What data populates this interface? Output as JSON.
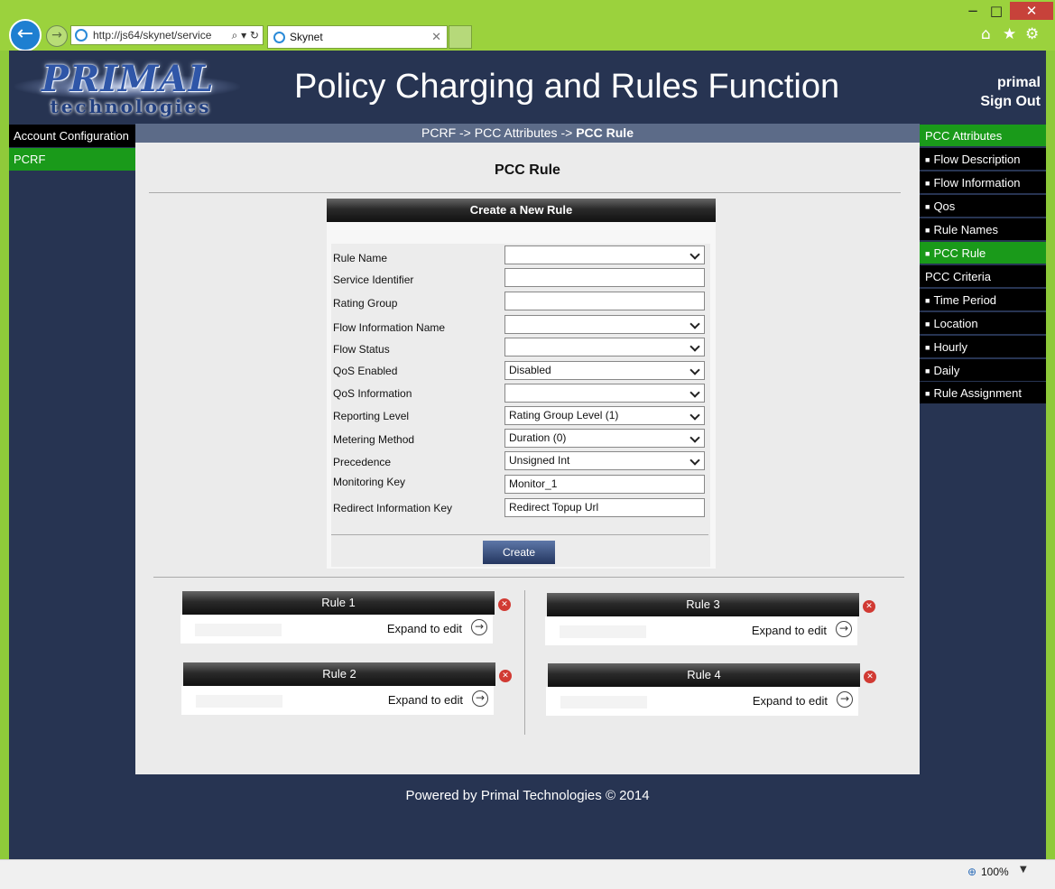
{
  "browser": {
    "address_url": "http://js64/skynet/service",
    "tab_title": "Skynet",
    "minimize": "−",
    "maximize": "□",
    "close": "✕",
    "zoom": "100%"
  },
  "header": {
    "logo_word1": "PRIMAL",
    "logo_word2": "technologies",
    "title": "Policy Charging and Rules Function",
    "user": "primal",
    "sign_out": "Sign Out"
  },
  "left_nav": [
    "Account Configuration",
    "PCRF"
  ],
  "breadcrumb": {
    "path": "PCRF -> PCC Attributes -> ",
    "current": "PCC Rule"
  },
  "main": {
    "heading": "PCC Rule",
    "form": {
      "header": "Create a New Rule",
      "fields": [
        {
          "label": "Rule Name",
          "value": "",
          "type": "select"
        },
        {
          "label": "Service Identifier",
          "value": "",
          "type": "text"
        },
        {
          "label": "Rating Group",
          "value": "",
          "type": "text"
        },
        {
          "label": "Flow Information Name",
          "value": "",
          "type": "select"
        },
        {
          "label": "Flow Status",
          "value": "",
          "type": "select"
        },
        {
          "label": "QoS Enabled",
          "value": "Disabled",
          "type": "select"
        },
        {
          "label": "QoS Information",
          "value": "",
          "type": "select"
        },
        {
          "label": "Reporting Level",
          "value": "Rating Group Level (1)",
          "type": "select"
        },
        {
          "label": "Metering Method",
          "value": "Duration (0)",
          "type": "select"
        },
        {
          "label": "Precedence",
          "value": "Unsigned Int",
          "type": "select"
        },
        {
          "label": "Monitoring Key",
          "value": "Monitor_1",
          "type": "text"
        },
        {
          "label": "Redirect Information Key",
          "value": "Redirect Topup Url",
          "type": "text"
        }
      ],
      "create_label": "Create"
    },
    "rules": [
      {
        "title": "Rule 1",
        "expand": "Expand to edit"
      },
      {
        "title": "Rule 2",
        "expand": "Expand to edit"
      },
      {
        "title": "Rule 3",
        "expand": "Expand to edit"
      },
      {
        "title": "Rule 4",
        "expand": "Expand to edit"
      }
    ]
  },
  "right_nav": [
    {
      "label": "PCC Attributes",
      "kind": "group-active"
    },
    {
      "label": "Flow Description",
      "kind": "item"
    },
    {
      "label": "Flow Information",
      "kind": "item"
    },
    {
      "label": "Qos",
      "kind": "item"
    },
    {
      "label": "Rule Names",
      "kind": "item"
    },
    {
      "label": "PCC Rule",
      "kind": "item-active"
    },
    {
      "label": "PCC Criteria",
      "kind": "group"
    },
    {
      "label": "Time Period",
      "kind": "item"
    },
    {
      "label": "Location",
      "kind": "item"
    },
    {
      "label": "Hourly",
      "kind": "item"
    },
    {
      "label": "Daily",
      "kind": "item"
    },
    {
      "label": "Rule Assignment",
      "kind": "item"
    }
  ],
  "footer": "Powered by Primal Technologies © 2014",
  "colors": {
    "browser_frame": "#9bd23d",
    "page_bg": "#273452",
    "nav_active": "#1a9a1a",
    "button_blue": "#24365f"
  }
}
